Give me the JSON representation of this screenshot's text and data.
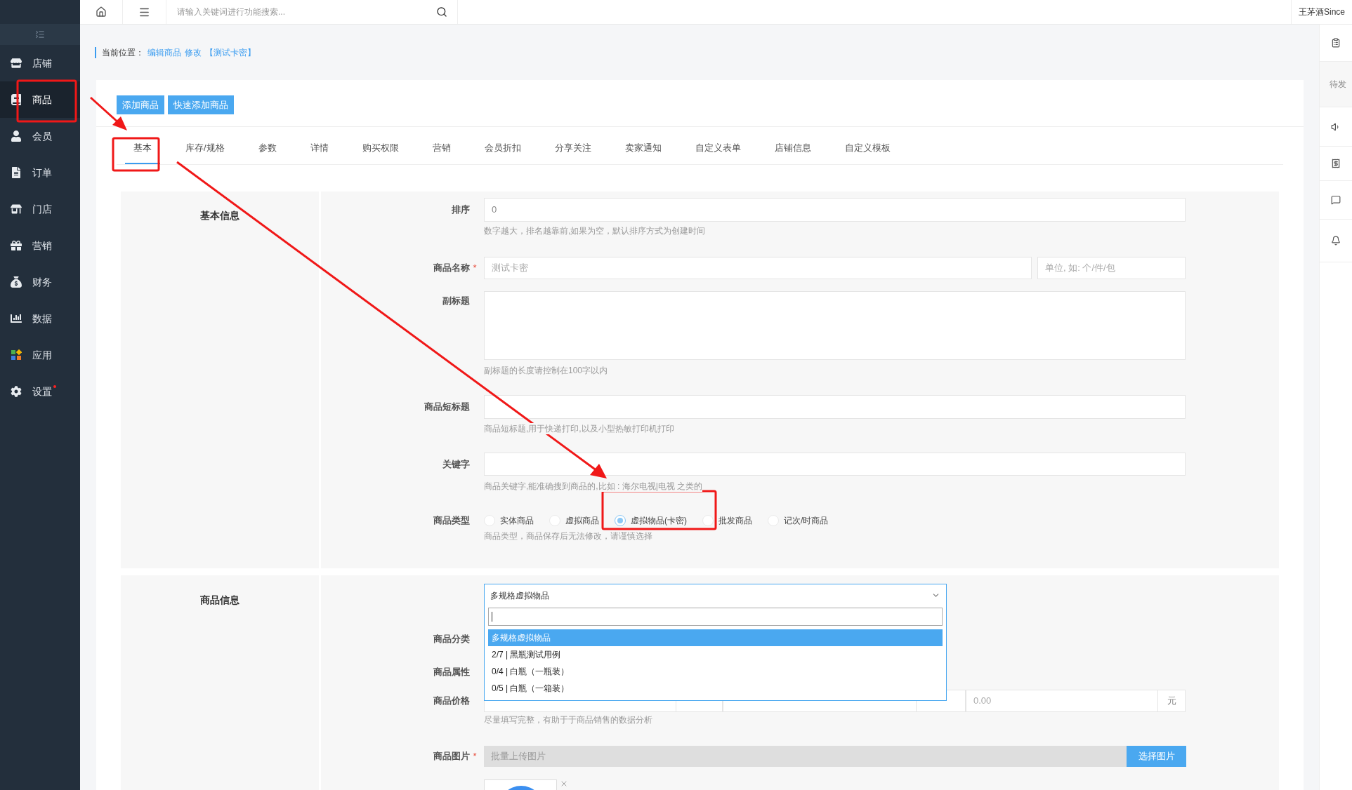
{
  "topbar": {
    "search": {
      "placeholder": "请输入关键词进行功能搜索..."
    },
    "user": "王茅酒Since"
  },
  "sidebar": {
    "items": [
      {
        "label": "店铺",
        "selected": false,
        "badge_dot": false
      },
      {
        "label": "商品",
        "selected": true,
        "badge_dot": false
      },
      {
        "label": "会员",
        "selected": false,
        "badge_dot": false
      },
      {
        "label": "订单",
        "selected": false,
        "badge_dot": false
      },
      {
        "label": "门店",
        "selected": false,
        "badge_dot": false
      },
      {
        "label": "营销",
        "selected": false,
        "badge_dot": false
      },
      {
        "label": "财务",
        "selected": false,
        "badge_dot": false
      },
      {
        "label": "数据",
        "selected": false,
        "badge_dot": false
      },
      {
        "label": "应用",
        "selected": false,
        "badge_dot": false
      },
      {
        "label": "设置",
        "selected": false,
        "badge_dot": true
      }
    ]
  },
  "right_panel": {
    "pending_label": "待发"
  },
  "breadcrumb": {
    "label": "当前位置：",
    "links": [
      "编辑商品",
      "修改",
      "【测试卡密】"
    ]
  },
  "actions": [
    "添加商品",
    "快速添加商品"
  ],
  "tabs": [
    {
      "label": "基本",
      "selected": true
    },
    {
      "label": "库存/规格",
      "selected": false
    },
    {
      "label": "参数",
      "selected": false
    },
    {
      "label": "详情",
      "selected": false
    },
    {
      "label": "购买权限",
      "selected": false
    },
    {
      "label": "营销",
      "selected": false
    },
    {
      "label": "会员折扣",
      "selected": false
    },
    {
      "label": "分享关注",
      "selected": false
    },
    {
      "label": "卖家通知",
      "selected": false
    },
    {
      "label": "自定义表单",
      "selected": false
    },
    {
      "label": "店铺信息",
      "selected": false
    },
    {
      "label": "自定义模板",
      "selected": false
    }
  ],
  "basic_info": {
    "title": "基本信息",
    "sort": {
      "label": "排序",
      "value": "0",
      "hint": "数字越大，排名越靠前,如果为空，默认排序方式为创建时间"
    },
    "name": {
      "label": "商品名称",
      "required_mark": "*",
      "placeholder": "测试卡密",
      "unit_placeholder": "单位, 如: 个/件/包"
    },
    "subtitle": {
      "label": "副标题",
      "hint": "副标题的长度请控制在100字以内"
    },
    "short_title": {
      "label": "商品短标题",
      "hint": "商品短标题,用于快递打印,以及小型热敏打印机打印"
    },
    "keywords": {
      "label": "关键字",
      "hint": "商品关键字,能准确搜到商品的,比如 : 海尔电视|电视 之类的"
    },
    "type": {
      "label": "商品类型",
      "options": [
        {
          "label": "实体商品",
          "selected": false
        },
        {
          "label": "虚拟商品",
          "selected": false
        },
        {
          "label": "虚拟物品(卡密)",
          "selected": true
        },
        {
          "label": "批发商品",
          "selected": false
        },
        {
          "label": "记次/时商品",
          "selected": false
        }
      ],
      "hint": "商品类型，商品保存后无法修改，请谨慎选择"
    }
  },
  "goods_info": {
    "title": "商品信息",
    "select": {
      "value": "多规格虚拟物品",
      "expanded": true,
      "options": [
        {
          "label": "多规格虚拟物品",
          "selected": true
        },
        {
          "label": "2/7 | 黑瓶测试用例",
          "selected": false
        },
        {
          "label": "0/4 | 白瓶（一瓶装）",
          "selected": false
        },
        {
          "label": "0/5 | 白瓶（一箱装）",
          "selected": false
        }
      ]
    },
    "category_label": "商品分类",
    "attribute_label": "商品属性",
    "price": {
      "label": "商品价格",
      "cost_placeholder": "0.00",
      "unit": "元",
      "hint": "尽量填写完整，有助于于商品销售的数据分析"
    },
    "images": {
      "label": "商品图片",
      "required_mark": "*",
      "placeholder": "批量上传图片",
      "button": "选择图片"
    }
  }
}
